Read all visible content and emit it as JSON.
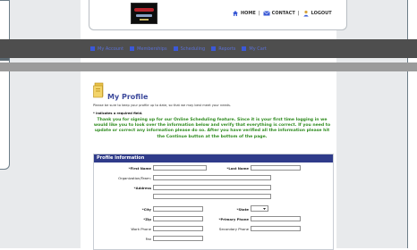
{
  "header": {
    "links": [
      {
        "label": "HOME",
        "icon": "home-icon"
      },
      {
        "label": "CONTACT",
        "icon": "mail-icon"
      },
      {
        "label": "LOGOUT",
        "icon": "user-icon"
      }
    ],
    "separator": "|"
  },
  "nav": {
    "items": [
      {
        "label": "My Account"
      },
      {
        "label": "Memberships"
      },
      {
        "label": "Scheduling"
      },
      {
        "label": "Reports"
      },
      {
        "label": "My Cart"
      }
    ]
  },
  "page": {
    "title": "My Profile",
    "note": "Please be sure to keep your profile up to date, so that we may best meet your needs.",
    "required_note": "* indicates a required field.",
    "welcome": "Thank you for signing up for our Online Scheduling feature. Since it is your first time logging in we would like you to look over the information below and verify that everything is correct. If you need to update or correct any information please do so. After you have verified all the information please hit the Continue button at the bottom of the page."
  },
  "profile": {
    "section_title": "Profile Information",
    "labels": {
      "first_name": "*First Name",
      "last_name": "*Last Name",
      "organization": "Organization/Team:",
      "address": "*Address",
      "city": "*City",
      "state": "*State",
      "zip": "*Zip",
      "primary_phone": "*Primary Phone",
      "work_phone": "Work Phone",
      "secondary_phone": "Secondary Phone",
      "fax": "Fax"
    },
    "state_value": "",
    "colors": {
      "section_header": "#2f3b8a",
      "welcome_text": "#2e8b1e",
      "nav_bar": "#4e4e4e"
    }
  }
}
